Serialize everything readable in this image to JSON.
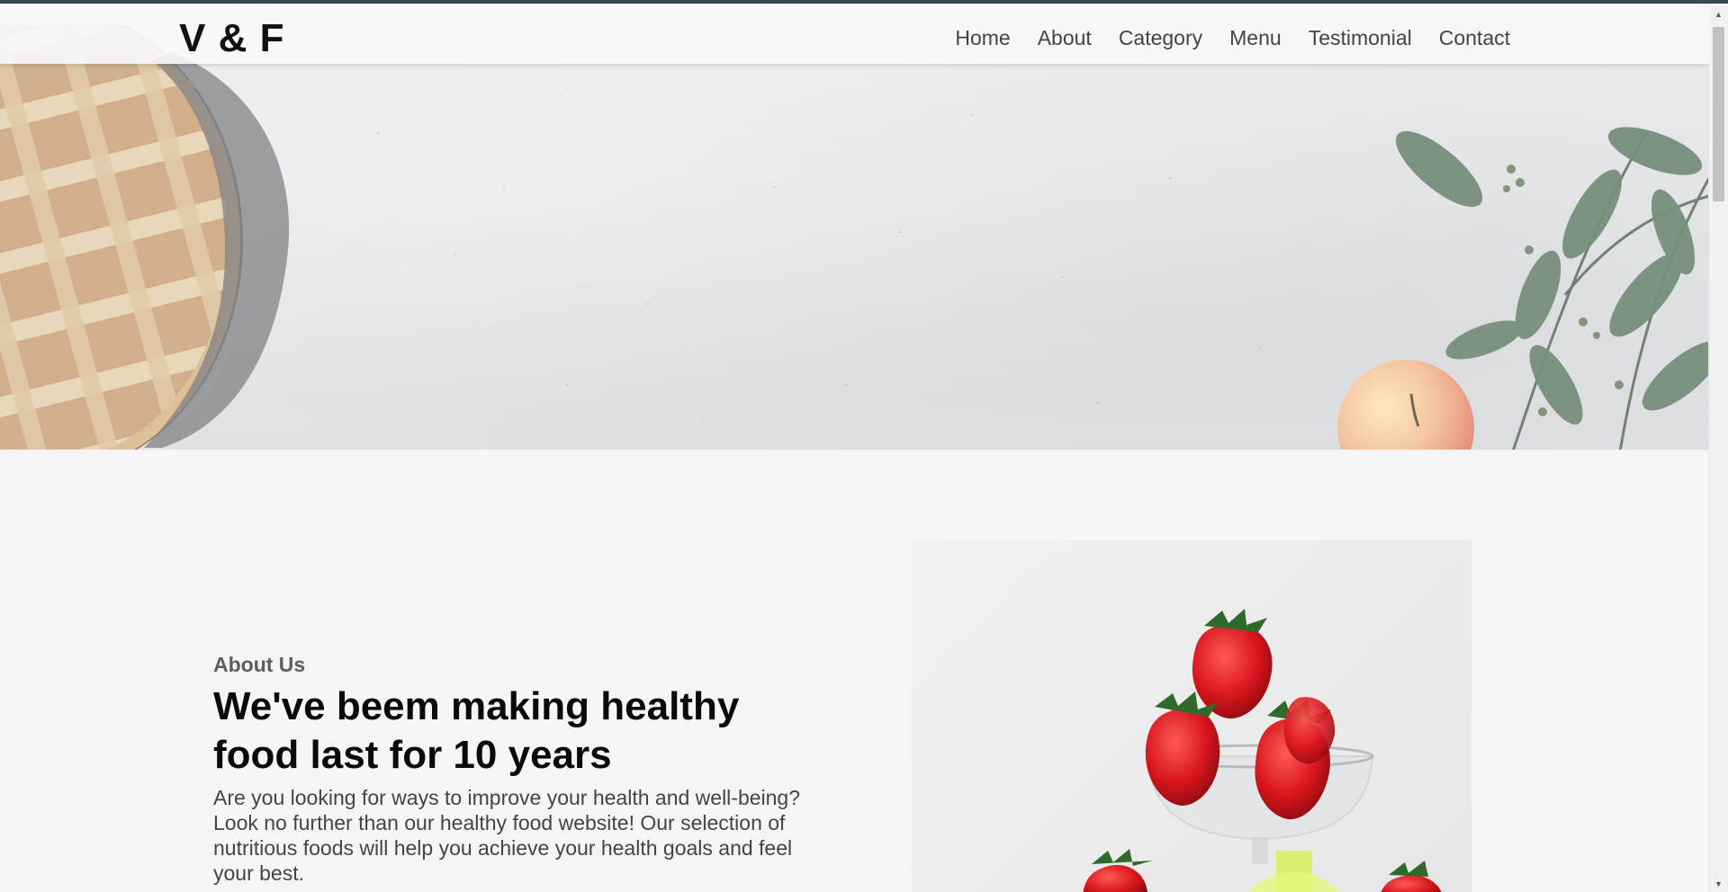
{
  "brand": {
    "logo": "V & F"
  },
  "nav": {
    "items": [
      {
        "label": "Home"
      },
      {
        "label": "About"
      },
      {
        "label": "Category"
      },
      {
        "label": "Menu"
      },
      {
        "label": "Testimonial"
      },
      {
        "label": "Contact"
      }
    ]
  },
  "about": {
    "eyebrow": "About Us",
    "headline": "We've beem making healthy food last for 10 years",
    "description": "Are you looking for ways to improve your health and well-being? Look no further than our healthy food website! Our selection of nutritious foods will help you achieve your health goals and feel your best."
  },
  "colors": {
    "background": "#f5f5f7",
    "header": "#f8f8f9",
    "text_dark": "#0a0a0a",
    "nav_text": "#444444",
    "top_border": "#37474f"
  },
  "icons": {
    "scroll_up": "triangle-up",
    "scroll_down": "triangle-down"
  }
}
